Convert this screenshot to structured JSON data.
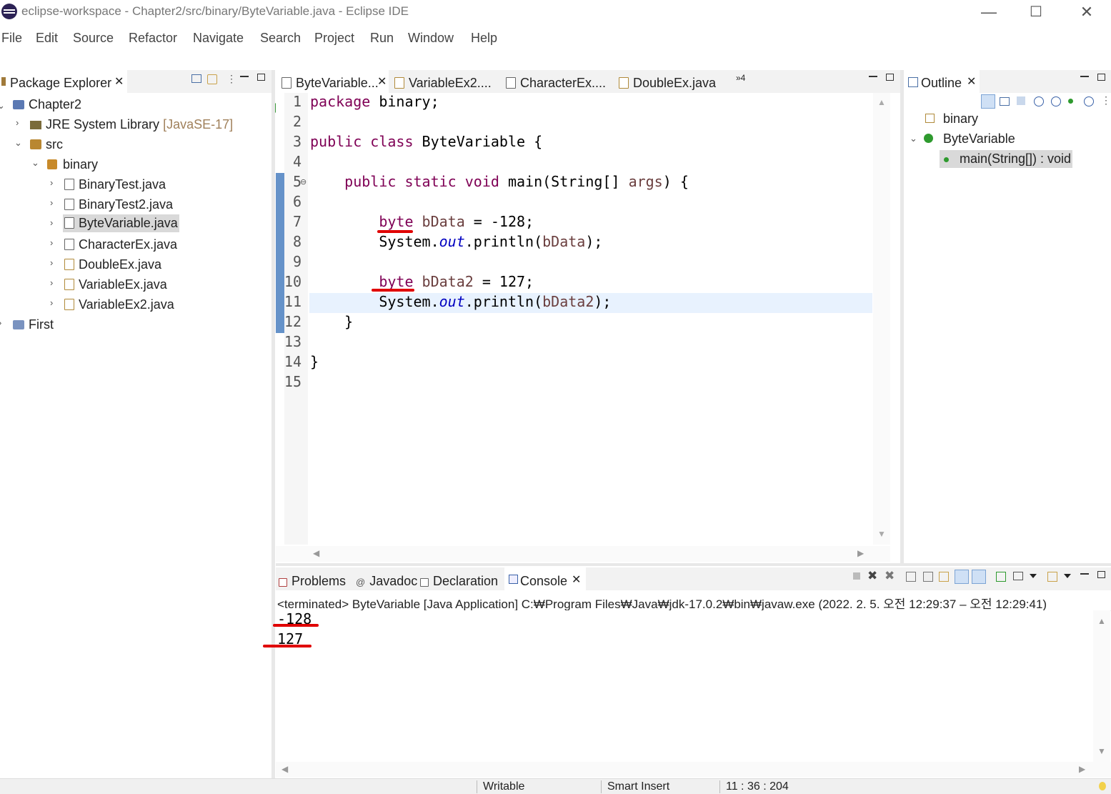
{
  "window": {
    "title": "eclipse-workspace - Chapter2/src/binary/ByteVariable.java - Eclipse IDE",
    "minimize": "—",
    "maximize": "☐",
    "close": "✕"
  },
  "menu": [
    "File",
    "Edit",
    "Source",
    "Refactor",
    "Navigate",
    "Search",
    "Project",
    "Run",
    "Window",
    "Help"
  ],
  "package_explorer": {
    "tab_label": "Package Explorer",
    "tree": {
      "project": "Chapter2",
      "jre": "JRE System Library",
      "jre_version": "[JavaSE-17]",
      "src": "src",
      "package": "binary",
      "files": [
        "BinaryTest.java",
        "BinaryTest2.java",
        "ByteVariable.java",
        "CharacterEx.java",
        "DoubleEx.java",
        "VariableEx.java",
        "VariableEx2.java"
      ],
      "selected_file": "ByteVariable.java",
      "other_project": "First"
    }
  },
  "editor": {
    "tabs": [
      "ByteVariable...",
      "VariableEx2....",
      "CharacterEx....",
      "DoubleEx.java"
    ],
    "active_tab": "ByteVariable...",
    "overflow": "»4",
    "current_line": 11,
    "lines": [
      "1",
      "2",
      "3",
      "4",
      "5",
      "6",
      "7",
      "8",
      "9",
      "10",
      "11",
      "12",
      "13",
      "14",
      "15"
    ]
  },
  "outline": {
    "tab_label": "Outline",
    "package": "binary",
    "class": "ByteVariable",
    "method": "main(String[]) : void"
  },
  "bottom": {
    "tabs": [
      "Problems",
      "Javadoc",
      "Declaration",
      "Console"
    ],
    "active_tab": "Console",
    "terminated_line": "<terminated> ByteVariable [Java Application] C:₩Program Files₩Java₩jdk-17.0.2₩bin₩javaw.exe  (2022. 2. 5. 오전 12:29:37 – 오전 12:29:41)",
    "output": [
      "-128",
      "127"
    ]
  },
  "status_bar": {
    "mode": "Writable",
    "insert": "Smart Insert",
    "position": "11 : 36 : 204"
  },
  "colors": {
    "keyword": "#7f0055",
    "static_field": "#0000c0",
    "local_var": "#6a3e3e",
    "annotation_underline": "#e00000",
    "current_line_bg": "#e8f2fe"
  }
}
